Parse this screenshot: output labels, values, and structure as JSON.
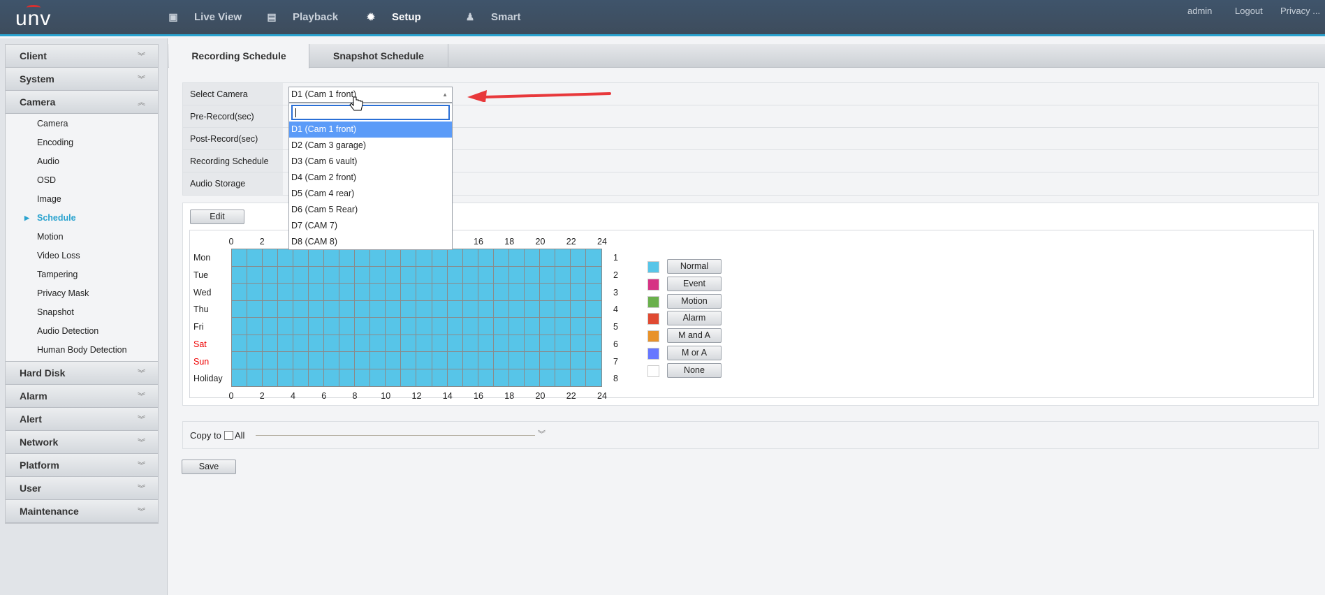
{
  "header": {
    "logo": "UNV",
    "nav": [
      {
        "label": "Live View",
        "icon": "monitor-icon"
      },
      {
        "label": "Playback",
        "icon": "film-icon"
      },
      {
        "label": "Setup",
        "icon": "gear-icon",
        "active": true
      },
      {
        "label": "Smart",
        "icon": "person-icon"
      }
    ],
    "user": "admin",
    "logout": "Logout",
    "privacy": "Privacy ..."
  },
  "sidebar": {
    "sections": [
      {
        "label": "Client"
      },
      {
        "label": "System"
      },
      {
        "label": "Camera",
        "expanded": true,
        "items": [
          "Camera",
          "Encoding",
          "Audio",
          "OSD",
          "Image",
          "Schedule",
          "Motion",
          "Video Loss",
          "Tampering",
          "Privacy Mask",
          "Snapshot",
          "Audio Detection",
          "Human Body Detection"
        ],
        "active": "Schedule"
      },
      {
        "label": "Hard Disk"
      },
      {
        "label": "Alarm"
      },
      {
        "label": "Alert"
      },
      {
        "label": "Network"
      },
      {
        "label": "Platform"
      },
      {
        "label": "User"
      },
      {
        "label": "Maintenance"
      }
    ]
  },
  "tabs": [
    "Recording Schedule",
    "Snapshot Schedule"
  ],
  "form": {
    "labels": [
      "Select Camera",
      "Pre-Record(sec)",
      "Post-Record(sec)",
      "Recording Schedule",
      "Audio Storage"
    ],
    "selected_camera": "D1 (Cam 1 front)",
    "search_value": "",
    "options": [
      "D1 (Cam 1 front)",
      "D2 (Cam 3 garage)",
      "D3 (Cam 6 vault)",
      "D4 (Cam 2 front)",
      "D5 (Cam 4 rear)",
      "D6 (Cam 5 Rear)",
      "D7 (CAM 7)",
      "D8 (CAM 8)"
    ]
  },
  "schedule": {
    "edit": "Edit",
    "hours": [
      "0",
      "2",
      "4",
      "6",
      "8",
      "10",
      "12",
      "14",
      "16",
      "18",
      "20",
      "22",
      "24"
    ],
    "days": [
      "Mon",
      "Tue",
      "Wed",
      "Thu",
      "Fri",
      "Sat",
      "Sun",
      "Holiday"
    ],
    "row_numbers": [
      "1",
      "2",
      "3",
      "4",
      "5",
      "6",
      "7",
      "8"
    ],
    "fill_type": "Normal",
    "legend": [
      {
        "label": "Normal",
        "color": "#57c5e8"
      },
      {
        "label": "Event",
        "color": "#d63384"
      },
      {
        "label": "Motion",
        "color": "#6ab04c"
      },
      {
        "label": "Alarm",
        "color": "#e04a32"
      },
      {
        "label": "M and A",
        "color": "#e8922a"
      },
      {
        "label": "M or A",
        "color": "#6677ff"
      },
      {
        "label": "None",
        "color": "#ffffff"
      }
    ]
  },
  "copy": {
    "label": "Copy to",
    "all": "All",
    "checked": false
  },
  "save": "Save",
  "colors": {
    "accent": "#2aa3cf",
    "header": "#3f546b",
    "weekend": "#e00000",
    "annotation_arrow": "#e8383b"
  }
}
